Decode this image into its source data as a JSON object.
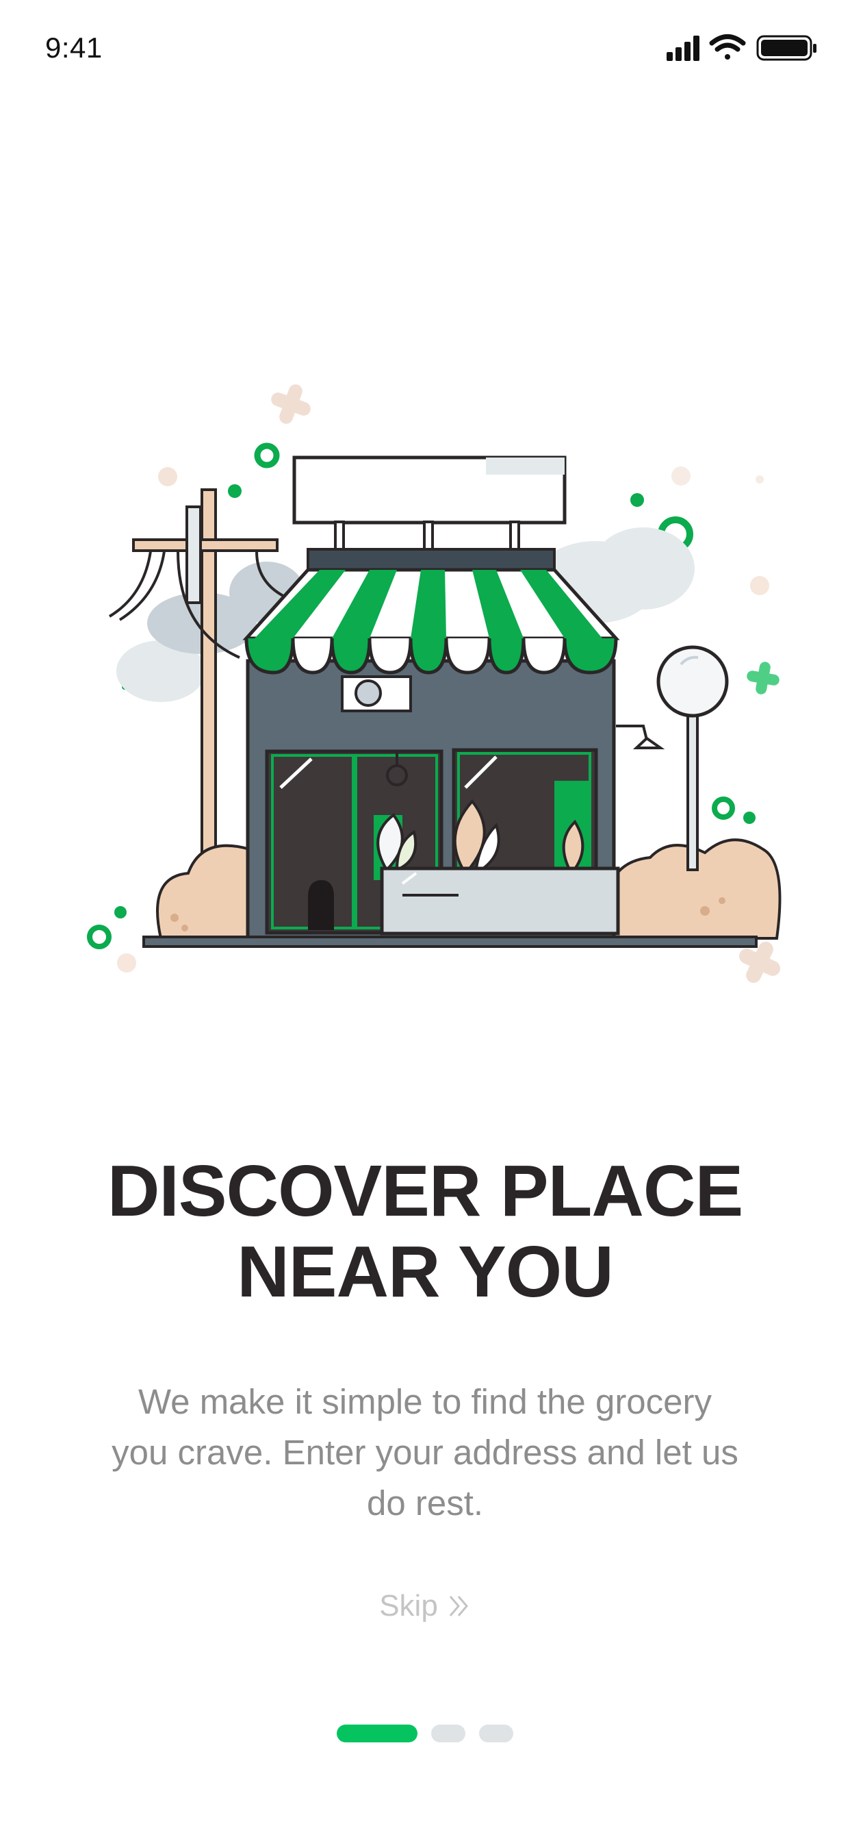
{
  "status_bar": {
    "time": "9:41",
    "icons": [
      "cellular-signal-icon",
      "wifi-icon",
      "battery-icon"
    ]
  },
  "illustration": {
    "description_icon": "grocery-store-illustration",
    "colors": {
      "green": "#0bab4e",
      "dark_wall": "#5c6b76",
      "window": "#3e3839",
      "beige": "#efcfb3",
      "cloud": "#e4e9ec"
    }
  },
  "onboarding": {
    "title_line1": "DISCOVER PLACE",
    "title_line2": "NEAR YOU",
    "subtitle_line1": "We make it simple to find the grocery",
    "subtitle_line2": "you crave. Enter your address and let us",
    "subtitle_line3": "do rest.",
    "skip_label": "Skip",
    "skip_icon": "double-chevron-right-icon"
  },
  "pagination": {
    "total": 3,
    "active_index": 0,
    "active_color": "#05c460",
    "inactive_color": "#dfe3e6"
  }
}
